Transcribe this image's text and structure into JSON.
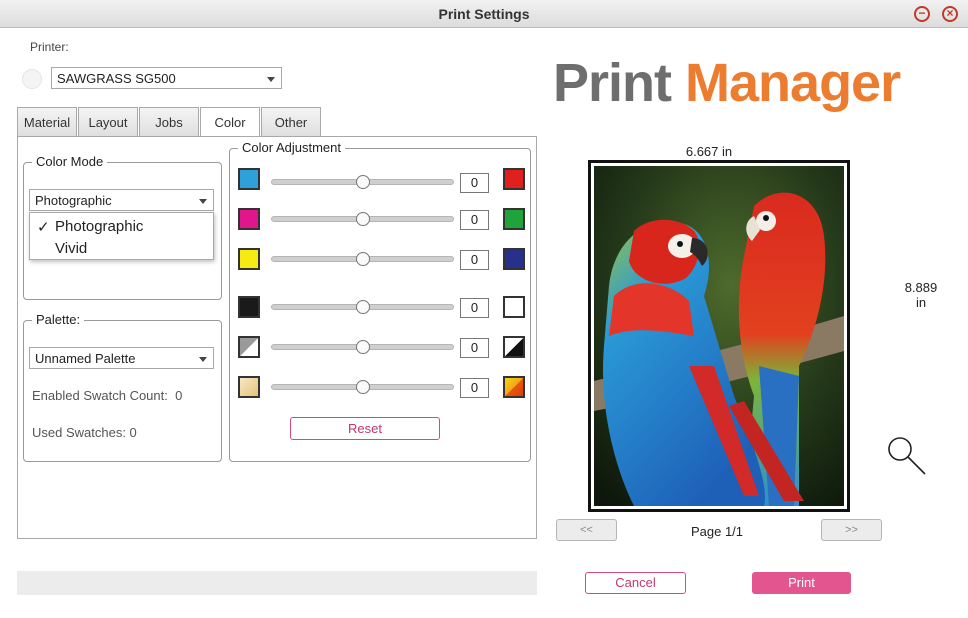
{
  "window": {
    "title": "Print Settings"
  },
  "printer": {
    "label": "Printer:",
    "selected": "SAWGRASS SG500"
  },
  "tabs": [
    {
      "label": "Material",
      "active": false
    },
    {
      "label": "Layout",
      "active": false
    },
    {
      "label": "Jobs",
      "active": false
    },
    {
      "label": "Color",
      "active": true
    },
    {
      "label": "Other",
      "active": false
    }
  ],
  "color_mode": {
    "title": "Color Mode",
    "selected": "Photographic",
    "options": [
      {
        "label": "Photographic",
        "checked": true,
        "check_mark": "✓"
      },
      {
        "label": "Vivid",
        "checked": false,
        "check_mark": ""
      }
    ]
  },
  "palette": {
    "title": "Palette:",
    "selected": "Unnamed Palette",
    "enabled_swatch_count": "Enabled Swatch Count:  0",
    "used_swatches": "Used Swatches: 0"
  },
  "color_adjustment": {
    "title": "Color Adjustment",
    "reset_label": "Reset",
    "rows": [
      {
        "left_color": "cyan",
        "right_color": "red",
        "value": "0",
        "position": 0.5
      },
      {
        "left_color": "magenta",
        "right_color": "green",
        "value": "0",
        "position": 0.5
      },
      {
        "left_color": "yellow",
        "right_color": "blue",
        "value": "0",
        "position": 0.5
      },
      {
        "left_color": "black",
        "right_color": "white",
        "value": "0",
        "position": 0.5
      },
      {
        "left_color": "contrast",
        "right_color": "contrast-inverse",
        "value": "0",
        "position": 0.5
      },
      {
        "left_color": "warm-light",
        "right_color": "warm-saturated",
        "value": "0",
        "position": 0.5
      }
    ]
  },
  "logo": {
    "word1": "Print",
    "word2": "Manager"
  },
  "preview": {
    "width_label": "6.667 in",
    "height_value": "8.889",
    "height_unit": "in",
    "page": "Page 1/1",
    "prev_label": "<<",
    "next_label": ">>"
  },
  "footer": {
    "cancel_label": "Cancel",
    "print_label": "Print",
    "progress": 0
  },
  "colors": {
    "accent": "#e2558f",
    "logo_gray": "#6e6e6e",
    "logo_orange": "#ec7c30"
  }
}
